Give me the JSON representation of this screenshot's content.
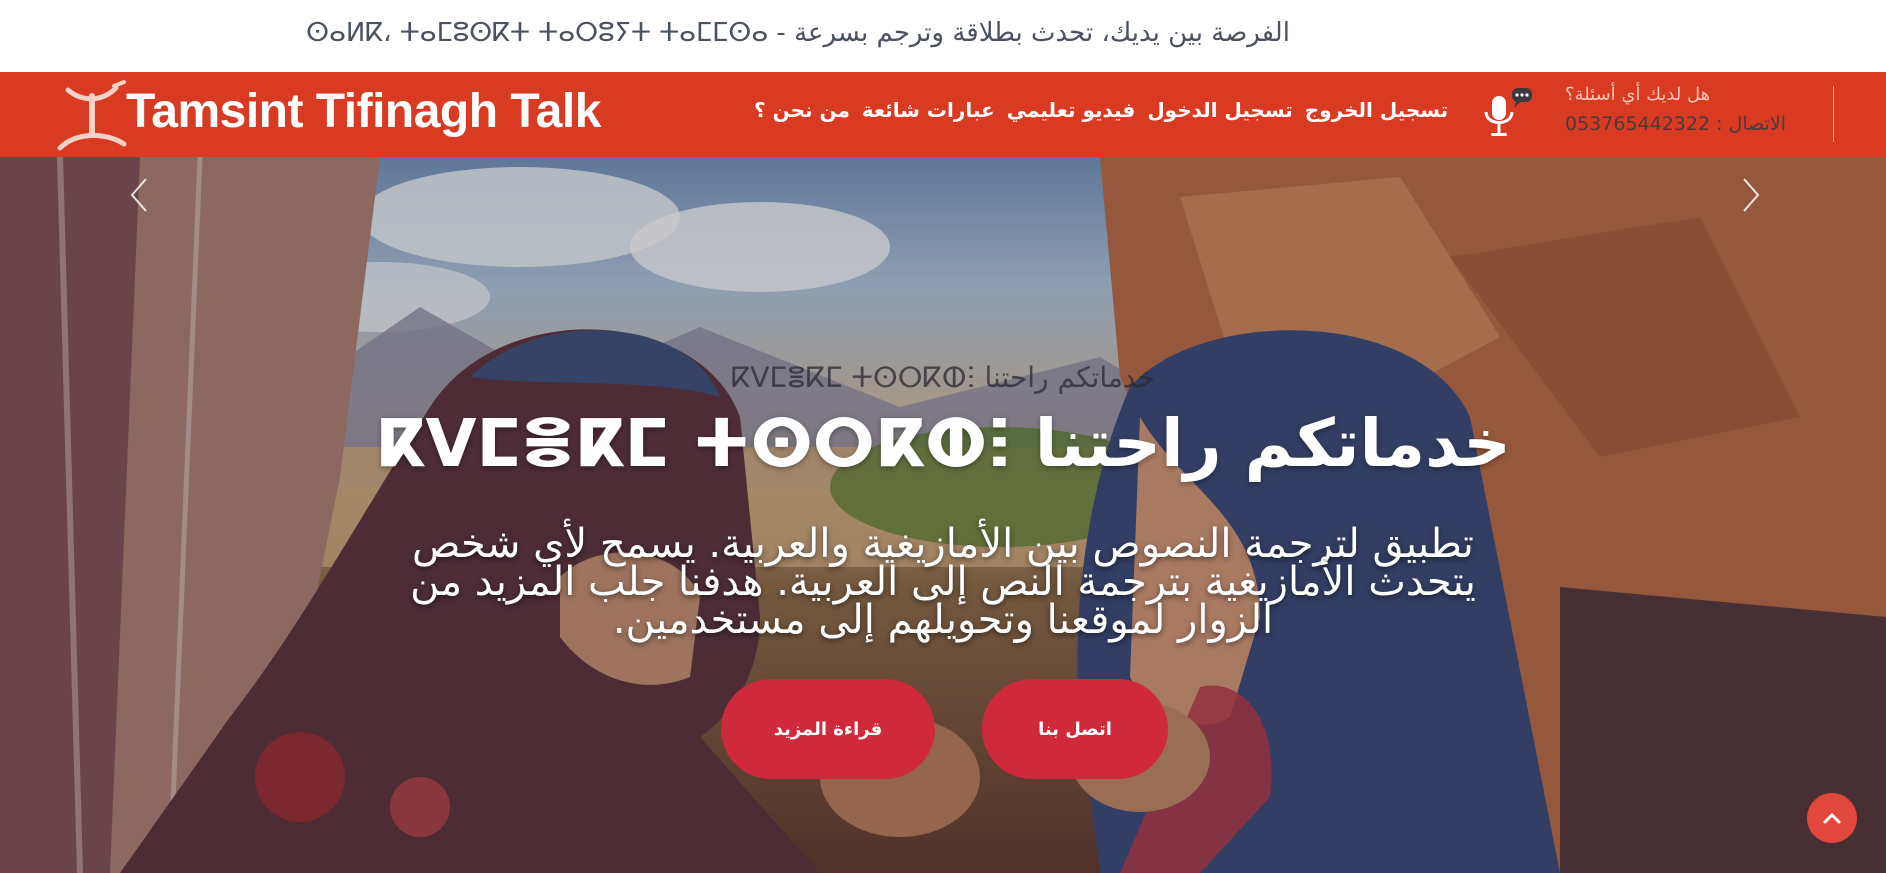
{
  "top_strip": {
    "tagline": "ⵙⴰⵍⴽ، ⵜⴰⵎⵓⵙⴽⵜ ⵜⴰⵔⵓⵢⵜ ⵜⴰⵎⵎⵙⴰ - الفرصة بين يديك، تحدث بطلاقة وترجم بسرعة"
  },
  "navbar": {
    "brand": "Tamsint Tifinagh Talk",
    "menu": [
      {
        "label": "تسجيل الخروج"
      },
      {
        "label": "تسجيل الدخول"
      },
      {
        "label": "فيديو تعليمي"
      },
      {
        "label": "عبارات شائعة"
      },
      {
        "label": "من نحن ؟"
      }
    ],
    "contact_question": "هل لديك أي أسئلة؟",
    "contact_phone": "الاتصال : 053765442322"
  },
  "hero": {
    "subtitle": "ⴽⴸⵎⴻⴽⵎ ⵜⵙⵔⴽⵀⵗ خدماتكم راحتنا",
    "title": "ⴽⴸⵎⴻⴽⵎ ⵜⵙⵔⴽⵀⵗ خدماتكم راحتنا",
    "description": "تطبيق لترجمة النصوص بين الأمازيغية والعربية. يسمح لأي شخص يتحدث الأمازيغية بترجمة النص إلى العربية. هدفنا جلب المزيد من الزوار لموقعنا وتحويلهم إلى مستخدمين.",
    "btn_read_more": "قراءة المزيد",
    "btn_contact": "اتصل بنا"
  },
  "colors": {
    "nav_red": "#d93a22",
    "button_red": "#cf2a3c",
    "scroll_top": "#e2473c"
  }
}
